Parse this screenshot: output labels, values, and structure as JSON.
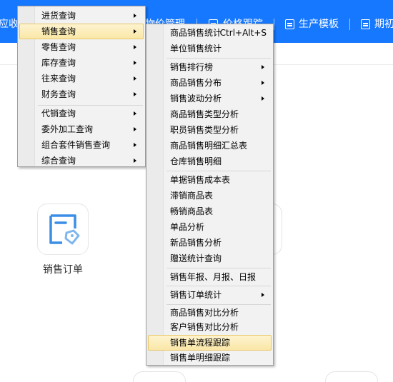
{
  "topbar": {
    "items": [
      "应收应付",
      "物价管理",
      "价格跟踪",
      "生产模板",
      "期初"
    ],
    "icons": [
      "price-track-icon",
      "production-template-icon",
      "opening-icon"
    ]
  },
  "app": {
    "label": "销售订单",
    "icon": "sales-order-icon",
    "accent": "#3a8ee6"
  },
  "menu1": {
    "items": [
      "进货查询",
      "销售查询",
      "零售查询",
      "库存查询",
      "往来查询",
      "财务查询",
      "代销查询",
      "委外加工查询",
      "组合套件销售查询",
      "综合查询"
    ],
    "highlighted": "销售查询"
  },
  "menu2": {
    "items": [
      "商品销售统计",
      "单位销售统计",
      "销售排行榜",
      "商品销售分布",
      "销售波动分析",
      "商品销售类型分析",
      "职员销售类型分析",
      "商品销售明细汇总表",
      "仓库销售明细",
      "单据销售成本表",
      "滞销商品表",
      "畅销商品表",
      "单品分析",
      "新品销售分析",
      "赠送统计查询",
      "销售年报、月报、日报",
      "销售订单统计",
      "商品销售对比分析",
      "客户销售对比分析",
      "销售单流程跟踪",
      "销售单明细跟踪"
    ],
    "shortcut": "Ctrl+Alt+S",
    "highlighted": "销售单流程跟踪"
  },
  "colors": {
    "topbar": "#1677ff",
    "menu_highlight": "#fae7a7"
  }
}
